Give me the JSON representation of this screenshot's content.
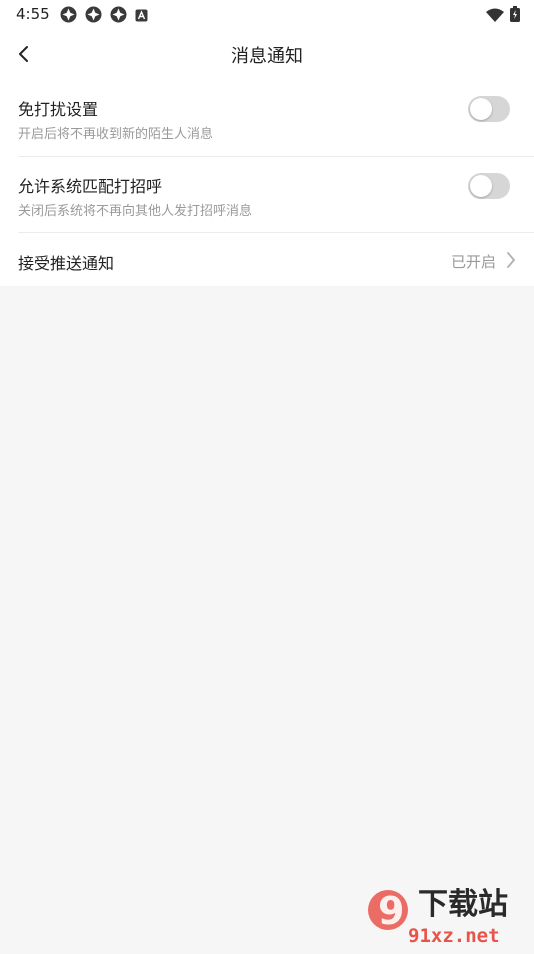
{
  "status_bar": {
    "time": "4:55",
    "left_icons": [
      "notification-icon",
      "notification-icon",
      "notification-icon",
      "a-icon"
    ],
    "right_icons": [
      "wifi-icon",
      "battery-charging-icon"
    ]
  },
  "header": {
    "title": "消息通知"
  },
  "settings": {
    "items": [
      {
        "title": "免打扰设置",
        "subtitle": "开启后将不再收到新的陌生人消息",
        "toggle_on": false
      },
      {
        "title": "允许系统匹配打招呼",
        "subtitle": "关闭后系统将不再向其他人发打招呼消息",
        "toggle_on": false
      },
      {
        "title": "接受推送通知",
        "value": "已开启"
      }
    ]
  },
  "watermark": {
    "logo_text": "9",
    "brand": "下载站",
    "domain": "91xz.net"
  },
  "colors": {
    "background": "#f6f6f6",
    "toggle_off": "#d6d6d6",
    "secondary_text": "#9a9a9a",
    "watermark_red": "#e8534a"
  }
}
